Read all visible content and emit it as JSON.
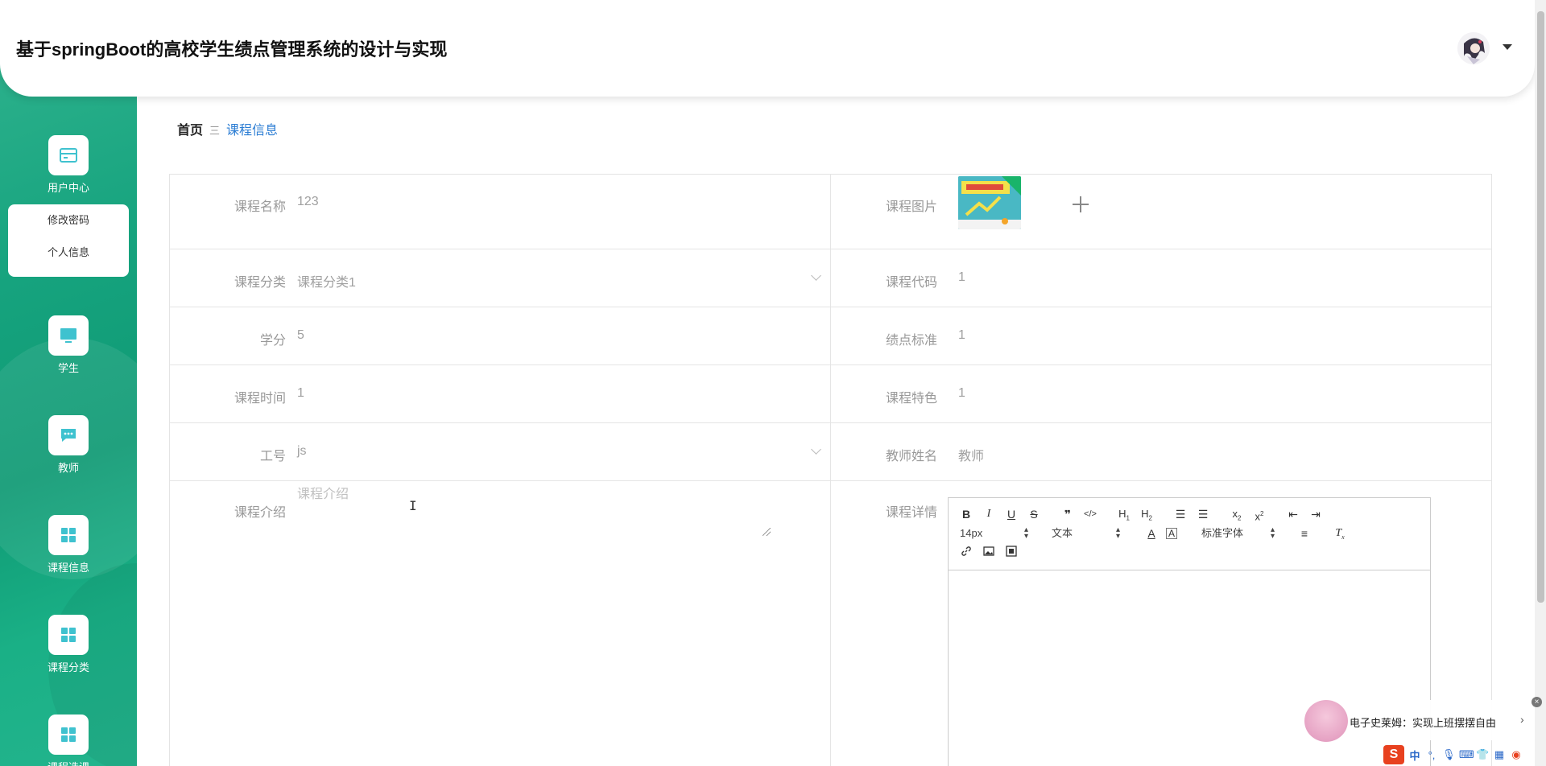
{
  "header": {
    "title": "基于springBoot的高校学生绩点管理系统的设计与实现"
  },
  "sidebar": {
    "items": [
      {
        "label": "用户中心",
        "icon": "card-icon"
      },
      {
        "label": "学生",
        "icon": "monitor-icon"
      },
      {
        "label": "教师",
        "icon": "chat-icon"
      },
      {
        "label": "课程信息",
        "icon": "grid-icon"
      },
      {
        "label": "课程分类",
        "icon": "grid-icon"
      },
      {
        "label": "课程选课",
        "icon": "grid-icon"
      }
    ],
    "submenu": [
      "修改密码",
      "个人信息"
    ]
  },
  "breadcrumb": {
    "home": "首页",
    "separator": "三",
    "current": "课程信息"
  },
  "form": {
    "course_name": {
      "label": "课程名称",
      "value": "123"
    },
    "course_image": {
      "label": "课程图片"
    },
    "course_category": {
      "label": "课程分类",
      "value": "课程分类1"
    },
    "course_code": {
      "label": "课程代码",
      "value": "1"
    },
    "credit": {
      "label": "学分",
      "value": "5"
    },
    "gpa_standard": {
      "label": "绩点标准",
      "value": "1"
    },
    "course_time": {
      "label": "课程时间",
      "value": "1"
    },
    "course_feature": {
      "label": "课程特色",
      "value": "1"
    },
    "teacher_id": {
      "label": "工号",
      "value": "js"
    },
    "teacher_name": {
      "label": "教师姓名",
      "value": "教师"
    },
    "course_intro": {
      "label": "课程介绍",
      "placeholder": "课程介绍"
    },
    "course_detail": {
      "label": "课程详情"
    }
  },
  "editor": {
    "font_size": "14px",
    "text_type": "文本",
    "font_family": "标准字体"
  },
  "widget": {
    "text": "电子史莱姆：实现上班摆摆自由"
  },
  "colors": {
    "accent": "#2a7cd3",
    "sidebar": "#16a37e",
    "sogou": "#e8411f"
  }
}
